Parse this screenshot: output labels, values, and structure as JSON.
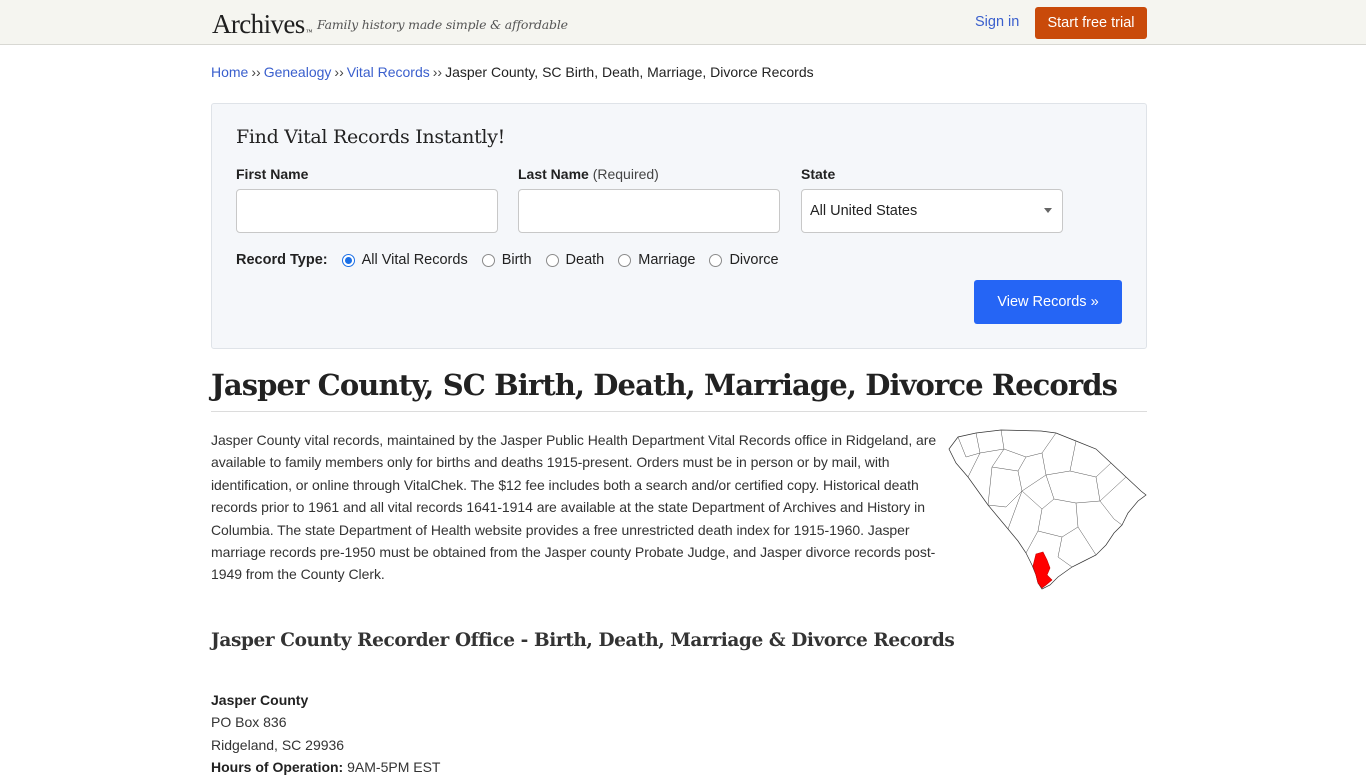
{
  "header": {
    "logo": "Archives",
    "logo_mark": "™",
    "tagline": "Family history made simple & affordable",
    "sign_in": "Sign in",
    "start_trial": "Start free trial"
  },
  "breadcrumb": {
    "items": [
      "Home",
      "Genealogy",
      "Vital Records"
    ],
    "separator": "››",
    "current": "Jasper County, SC Birth, Death, Marriage, Divorce Records"
  },
  "search": {
    "title": "Find Vital Records Instantly!",
    "first_name_label": "First Name",
    "first_name_value": "",
    "last_name_label": "Last Name",
    "last_name_required": "(Required)",
    "last_name_value": "",
    "state_label": "State",
    "state_selected": "All United States",
    "record_type_label": "Record Type:",
    "record_types": [
      {
        "label": "All Vital Records",
        "checked": true
      },
      {
        "label": "Birth",
        "checked": false
      },
      {
        "label": "Death",
        "checked": false
      },
      {
        "label": "Marriage",
        "checked": false
      },
      {
        "label": "Divorce",
        "checked": false
      }
    ],
    "submit": "View Records »"
  },
  "main": {
    "title": "Jasper County, SC Birth, Death, Marriage, Divorce Records",
    "intro": "Jasper County vital records, maintained by the Jasper Public Health Department Vital Records office in Ridgeland, are available to family members only for births and deaths 1915-present. Orders must be in person or by mail, with identification, or online through VitalChek. The $12 fee includes both a search and/or certified copy. Historical death records prior to 1961 and all vital records 1641-1914 are available at the state Department of Archives and History in Columbia. The state Department of Health website provides a free unrestricted death index for 1915-1960. Jasper marriage records pre-1950 must be obtained from the Jasper county Probate Judge, and Jasper divorce records post-1949 from the County Clerk.",
    "map_highlight_color": "#ff0000",
    "subtitle": "Jasper County Recorder Office - Birth, Death, Marriage & Divorce Records",
    "office": {
      "name": "Jasper County",
      "address_line1": "PO Box 836",
      "address_line2": "Ridgeland, SC 29936",
      "hours_label": "Hours of Operation:",
      "hours_value": "9AM-5PM EST"
    }
  },
  "colors": {
    "link": "#3a5fcd",
    "trial_button": "#c94a0a",
    "view_button": "#2565f5",
    "panel_bg": "#f5f7fa"
  }
}
